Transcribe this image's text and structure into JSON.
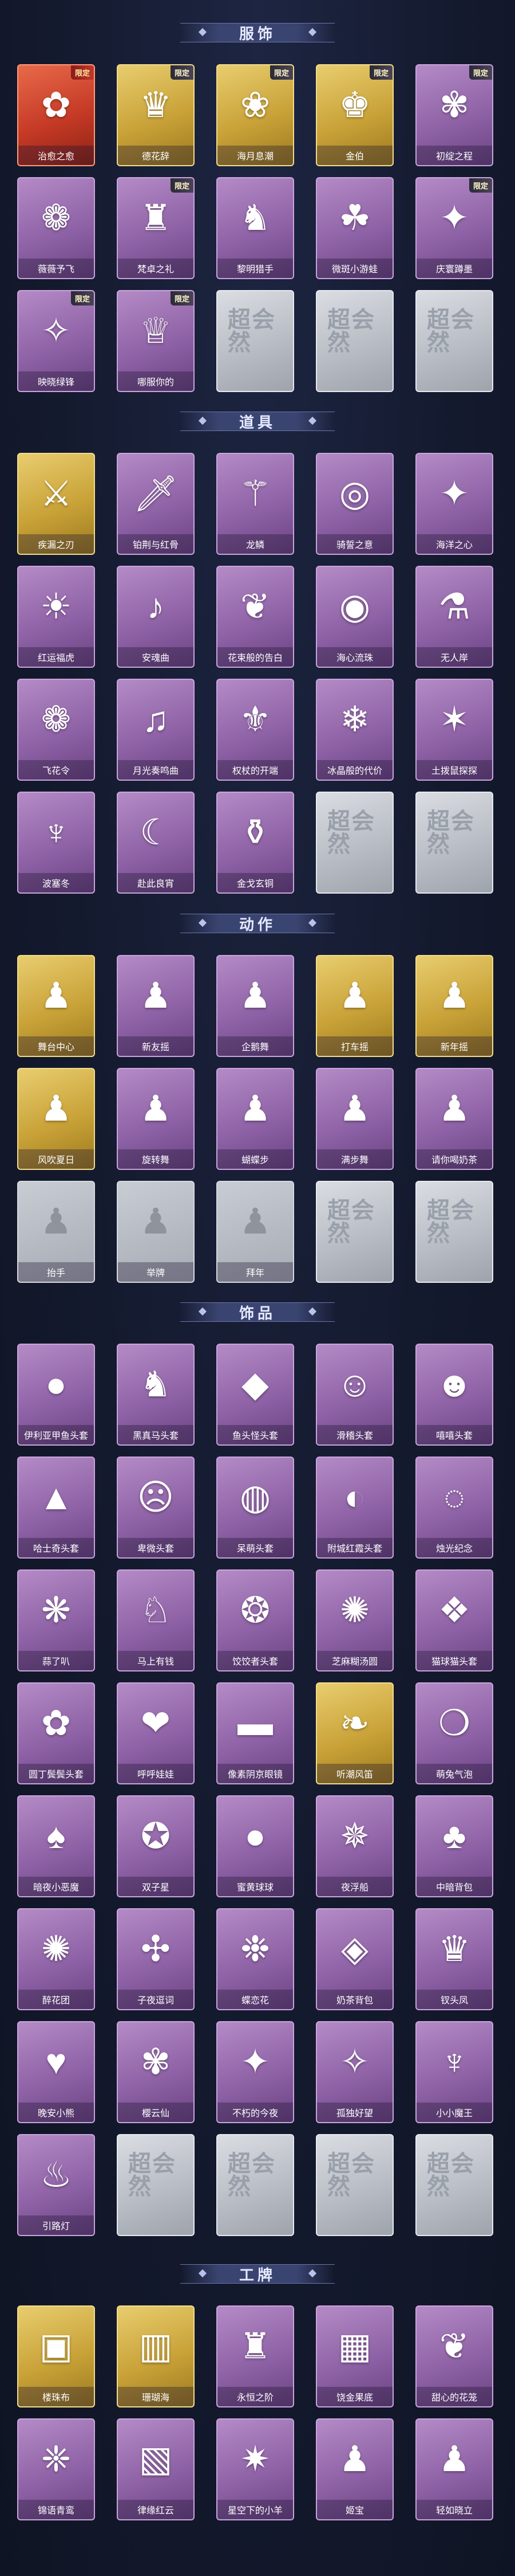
{
  "sections": [
    {
      "title": "服饰",
      "items": [
        {
          "label": "治愈之愈",
          "style": "red",
          "icon": "✿",
          "badge": "限定"
        },
        {
          "label": "德花辞",
          "style": "gold",
          "icon": "♛",
          "badge": "限定"
        },
        {
          "label": "海月息潮",
          "style": "gold",
          "icon": "❀",
          "badge": "限定"
        },
        {
          "label": "金伯",
          "style": "gold",
          "icon": "♚",
          "badge": "限定"
        },
        {
          "label": "初绽之程",
          "style": "purple",
          "icon": "✾",
          "badge": "限定"
        },
        {
          "label": "薇薇予飞",
          "style": "purple",
          "icon": "❁",
          "badge": ""
        },
        {
          "label": "梵卓之礼",
          "style": "purple",
          "icon": "♜",
          "badge": "限定"
        },
        {
          "label": "黎明猎手",
          "style": "purple",
          "icon": "♞",
          "badge": ""
        },
        {
          "label": "微斑小游蛙",
          "style": "purple",
          "icon": "☘",
          "badge": ""
        },
        {
          "label": "庆寰蹲墨",
          "style": "purple",
          "icon": "✦",
          "badge": "限定"
        },
        {
          "label": "映晓绿锋",
          "style": "purple",
          "icon": "✧",
          "badge": "限定"
        },
        {
          "label": "哪服你的",
          "style": "purple",
          "icon": "♕",
          "badge": "限定"
        },
        {
          "label": "",
          "style": "silver",
          "icon": "超会然",
          "badge": ""
        },
        {
          "label": "",
          "style": "silver",
          "icon": "超会然",
          "badge": ""
        },
        {
          "label": "",
          "style": "silver",
          "icon": "超会然",
          "badge": ""
        }
      ]
    },
    {
      "title": "道具",
      "items": [
        {
          "label": "疾漏之刃",
          "style": "gold",
          "icon": "⚔",
          "badge": ""
        },
        {
          "label": "铂荆与红骨",
          "style": "purple",
          "icon": "🗡",
          "badge": ""
        },
        {
          "label": "龙鳞",
          "style": "purple",
          "icon": "⚚",
          "badge": ""
        },
        {
          "label": "骑誓之意",
          "style": "purple",
          "icon": "◎",
          "badge": ""
        },
        {
          "label": "海洋之心",
          "style": "purple",
          "icon": "✦",
          "badge": ""
        },
        {
          "label": "红运福虎",
          "style": "purple",
          "icon": "☀",
          "badge": ""
        },
        {
          "label": "安魂曲",
          "style": "purple",
          "icon": "♪",
          "badge": ""
        },
        {
          "label": "花束般的告白",
          "style": "purple",
          "icon": "❦",
          "badge": ""
        },
        {
          "label": "海心流珠",
          "style": "purple",
          "icon": "◉",
          "badge": ""
        },
        {
          "label": "无人岸",
          "style": "purple",
          "icon": "⚗",
          "badge": ""
        },
        {
          "label": "飞花令",
          "style": "purple",
          "icon": "❁",
          "badge": ""
        },
        {
          "label": "月光奏鸣曲",
          "style": "purple",
          "icon": "♫",
          "badge": ""
        },
        {
          "label": "权杖的开端",
          "style": "purple",
          "icon": "⚜",
          "badge": ""
        },
        {
          "label": "冰晶般的代价",
          "style": "purple",
          "icon": "❄",
          "badge": ""
        },
        {
          "label": "土拨鼠探探",
          "style": "purple",
          "icon": "✶",
          "badge": ""
        },
        {
          "label": "波塞冬",
          "style": "purple",
          "icon": "♆",
          "badge": ""
        },
        {
          "label": "赴此良宵",
          "style": "purple",
          "icon": "☾",
          "badge": ""
        },
        {
          "label": "金戈玄铜",
          "style": "purple",
          "icon": "⚱",
          "badge": ""
        },
        {
          "label": "",
          "style": "silver",
          "icon": "超会然",
          "badge": ""
        },
        {
          "label": "",
          "style": "silver",
          "icon": "超会然",
          "badge": ""
        }
      ]
    },
    {
      "title": "动作",
      "items": [
        {
          "label": "舞台中心",
          "style": "gold",
          "icon": "♟",
          "badge": ""
        },
        {
          "label": "新友摇",
          "style": "purple",
          "icon": "♟",
          "badge": ""
        },
        {
          "label": "企鹅舞",
          "style": "purple",
          "icon": "♟",
          "badge": ""
        },
        {
          "label": "打车摇",
          "style": "gold",
          "icon": "♟",
          "badge": ""
        },
        {
          "label": "新年摇",
          "style": "gold",
          "icon": "♟",
          "badge": ""
        },
        {
          "label": "风吹夏日",
          "style": "gold",
          "icon": "♟",
          "badge": ""
        },
        {
          "label": "旋转舞",
          "style": "purple",
          "icon": "♟",
          "badge": ""
        },
        {
          "label": "蝴蝶步",
          "style": "purple",
          "icon": "♟",
          "badge": ""
        },
        {
          "label": "满步舞",
          "style": "purple",
          "icon": "♟",
          "badge": ""
        },
        {
          "label": "请你喝奶茶",
          "style": "purple",
          "icon": "♟",
          "badge": ""
        },
        {
          "label": "抬手",
          "style": "lockedgray",
          "icon": "♟",
          "badge": ""
        },
        {
          "label": "举牌",
          "style": "lockedgray",
          "icon": "♟",
          "badge": ""
        },
        {
          "label": "拜年",
          "style": "lockedgray",
          "icon": "♟",
          "badge": ""
        },
        {
          "label": "",
          "style": "silver",
          "icon": "超会然",
          "badge": ""
        },
        {
          "label": "",
          "style": "silver",
          "icon": "超会然",
          "badge": ""
        }
      ]
    },
    {
      "title": "饰品",
      "items": [
        {
          "label": "伊利亚甲鱼头套",
          "style": "purple",
          "icon": "●",
          "badge": ""
        },
        {
          "label": "黑真马头套",
          "style": "purple",
          "icon": "♞",
          "badge": ""
        },
        {
          "label": "鱼头怪头套",
          "style": "purple",
          "icon": "◆",
          "badge": ""
        },
        {
          "label": "滑稽头套",
          "style": "purple",
          "icon": "☺",
          "badge": ""
        },
        {
          "label": "嘻嘻头套",
          "style": "purple",
          "icon": "☻",
          "badge": ""
        },
        {
          "label": "哈士奇头套",
          "style": "purple",
          "icon": "▲",
          "badge": ""
        },
        {
          "label": "卑微头套",
          "style": "purple",
          "icon": "☹",
          "badge": ""
        },
        {
          "label": "呆萌头套",
          "style": "purple",
          "icon": "◍",
          "badge": ""
        },
        {
          "label": "附城红霞头套",
          "style": "purple",
          "icon": "◐",
          "badge": ""
        },
        {
          "label": "烛光纪念",
          "style": "purple",
          "icon": "◌",
          "badge": ""
        },
        {
          "label": "蒜了叭",
          "style": "purple",
          "icon": "❋",
          "badge": ""
        },
        {
          "label": "马上有钱",
          "style": "purple",
          "icon": "♘",
          "badge": ""
        },
        {
          "label": "饺饺者头套",
          "style": "purple",
          "icon": "❂",
          "badge": ""
        },
        {
          "label": "芝麻糊汤圆",
          "style": "purple",
          "icon": "✺",
          "badge": ""
        },
        {
          "label": "猫球猫头套",
          "style": "purple",
          "icon": "❖",
          "badge": ""
        },
        {
          "label": "圆丁鬓鬓头套",
          "style": "purple",
          "icon": "✿",
          "badge": ""
        },
        {
          "label": "呼呼娃娃",
          "style": "purple",
          "icon": "❤",
          "badge": ""
        },
        {
          "label": "像素阴京眼镜",
          "style": "purple",
          "icon": "▬",
          "badge": ""
        },
        {
          "label": "听潮风笛",
          "style": "gold",
          "icon": "❧",
          "badge": ""
        },
        {
          "label": "萌兔气泡",
          "style": "purple",
          "icon": "❍",
          "badge": ""
        },
        {
          "label": "暗夜小恶魔",
          "style": "purple",
          "icon": "♠",
          "badge": ""
        },
        {
          "label": "双子星",
          "style": "purple",
          "icon": "✪",
          "badge": ""
        },
        {
          "label": "蜜黄球球",
          "style": "purple",
          "icon": "●",
          "badge": ""
        },
        {
          "label": "夜浮船",
          "style": "purple",
          "icon": "✵",
          "badge": ""
        },
        {
          "label": "中暗背包",
          "style": "purple",
          "icon": "♣",
          "badge": ""
        },
        {
          "label": "醉花团",
          "style": "purple",
          "icon": "✺",
          "badge": ""
        },
        {
          "label": "子夜逗词",
          "style": "purple",
          "icon": "✣",
          "badge": ""
        },
        {
          "label": "蝶恋花",
          "style": "purple",
          "icon": "❉",
          "badge": ""
        },
        {
          "label": "奶茶背包",
          "style": "purple",
          "icon": "◈",
          "badge": ""
        },
        {
          "label": "钗头凤",
          "style": "purple",
          "icon": "♛",
          "badge": ""
        },
        {
          "label": "晚安小熊",
          "style": "purple",
          "icon": "♥",
          "badge": ""
        },
        {
          "label": "樱云仙",
          "style": "purple",
          "icon": "✾",
          "badge": ""
        },
        {
          "label": "不朽的今夜",
          "style": "purple",
          "icon": "✦",
          "badge": ""
        },
        {
          "label": "孤独好望",
          "style": "purple",
          "icon": "✧",
          "badge": ""
        },
        {
          "label": "小小魔王",
          "style": "purple",
          "icon": "♆",
          "badge": ""
        },
        {
          "label": "引路灯",
          "style": "purple",
          "icon": "♨",
          "badge": ""
        },
        {
          "label": "",
          "style": "silver",
          "icon": "超会然",
          "badge": ""
        },
        {
          "label": "",
          "style": "silver",
          "icon": "超会然",
          "badge": ""
        },
        {
          "label": "",
          "style": "silver",
          "icon": "超会然",
          "badge": ""
        },
        {
          "label": "",
          "style": "silver",
          "icon": "超会然",
          "badge": ""
        }
      ]
    },
    {
      "title": "工牌",
      "items": [
        {
          "label": "楼珠布",
          "style": "gold",
          "icon": "▣",
          "badge": ""
        },
        {
          "label": "珊瑚海",
          "style": "gold",
          "icon": "▥",
          "badge": ""
        },
        {
          "label": "永恒之阶",
          "style": "purple",
          "icon": "♜",
          "badge": ""
        },
        {
          "label": "饶金果底",
          "style": "purple",
          "icon": "▦",
          "badge": ""
        },
        {
          "label": "甜心的花笼",
          "style": "purple",
          "icon": "❦",
          "badge": ""
        },
        {
          "label": "锦语青鸾",
          "style": "purple",
          "icon": "❈",
          "badge": ""
        },
        {
          "label": "律缘红云",
          "style": "purple",
          "icon": "▧",
          "badge": ""
        },
        {
          "label": "星空下的小羊",
          "style": "purple",
          "icon": "✷",
          "badge": ""
        },
        {
          "label": "姬宝",
          "style": "purple",
          "icon": "♟",
          "badge": ""
        },
        {
          "label": "轻如晓立",
          "style": "purple",
          "icon": "♟",
          "badge": ""
        }
      ]
    }
  ]
}
